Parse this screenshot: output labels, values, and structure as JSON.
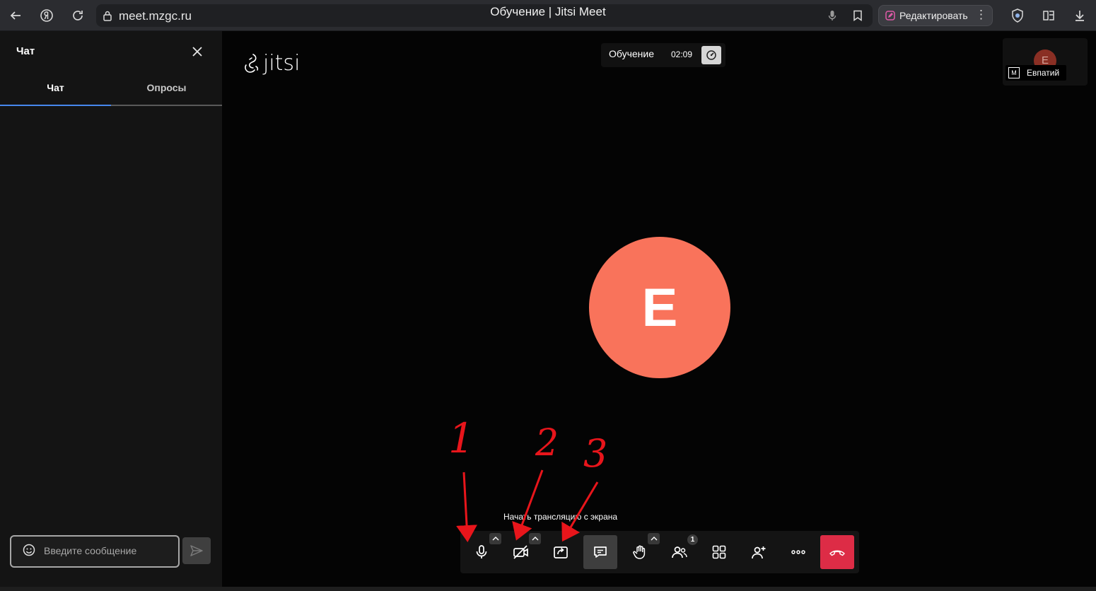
{
  "browser": {
    "url": "meet.mzgc.ru",
    "page_title": "Обучение | Jitsi Meet",
    "edit_label": "Редактировать"
  },
  "chat": {
    "title": "Чат",
    "tabs": [
      {
        "label": "Чат",
        "active": true
      },
      {
        "label": "Опросы",
        "active": false
      }
    ],
    "input_placeholder": "Введите сообщение"
  },
  "meeting": {
    "logo": "jitsi",
    "name": "Обучение",
    "timer": "02:09",
    "participant_name": "Евпатий",
    "participant_initial": "Е",
    "avatar_color": "#f9735b",
    "screen_share_tooltip": "Начать трансляцию с экрана",
    "participant_count": "1"
  },
  "toolbar": {
    "items": [
      "microphone-icon",
      "camera-off-icon",
      "screen-share-icon",
      "chat-icon",
      "raise-hand-icon",
      "participants-icon",
      "tile-view-icon",
      "invite-icon",
      "more-icon",
      "hangup-icon"
    ],
    "hangup_color": "#dd2c46",
    "active_item": "chat-icon"
  },
  "annotations": {
    "labels": [
      "1",
      "2",
      "3"
    ],
    "color": "#e8151b"
  }
}
